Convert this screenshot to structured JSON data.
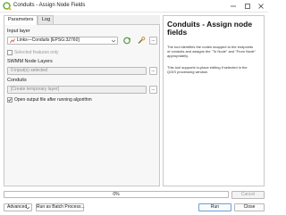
{
  "window": {
    "title": "Conduits - Assign Node Fields"
  },
  "tabs": [
    {
      "label": "Parameters"
    },
    {
      "label": "Log"
    }
  ],
  "form": {
    "input_layer_label": "Input layer",
    "input_layer_value": "Links—Conduits [EPSG:32760]",
    "selected_features_only": "Selected features only",
    "swmm_node_layers_label": "SWMM Node Layers",
    "swmm_node_layers_value": "0 input(s) selected",
    "conduits_label": "Conduits",
    "conduits_placeholder": "[Create temporary layer]",
    "open_output_label": "Open output file after running algorithm",
    "more_button": "..."
  },
  "help": {
    "title": "Conduits - Assign node fields",
    "p1": "The tool identifies the nodes snapped to the endpoints of conduits and assigns the \"To Node\" and \"From Node\" appropriately.",
    "p2": "This tool supports in-place editing if selected in the QGIS processing window."
  },
  "progress": {
    "text": "0%",
    "value": 0
  },
  "buttons": {
    "cancel": "Cancel",
    "advanced": "Advanced",
    "batch": "Run as Batch Process...",
    "run": "Run",
    "close": "Close"
  },
  "colors": {
    "accent": "#3a8fd8",
    "qgis_green": "#6cb33f"
  }
}
